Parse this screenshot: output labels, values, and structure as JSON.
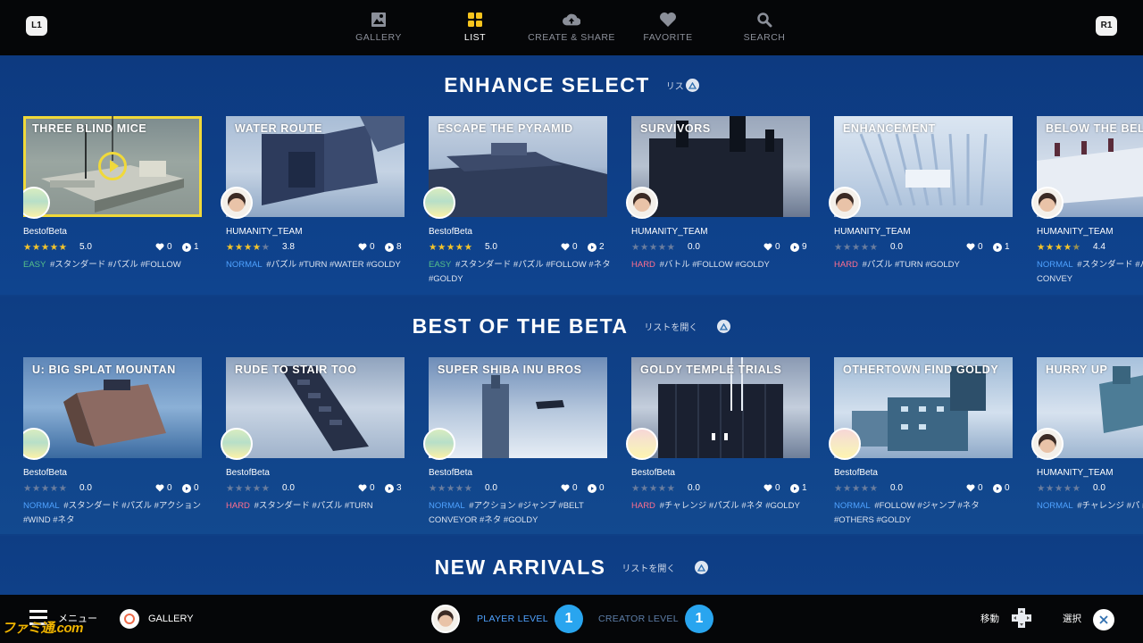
{
  "topbar": {
    "l1": "L1",
    "r1": "R1",
    "nav": [
      {
        "label": "GALLERY",
        "icon": "gallery-icon"
      },
      {
        "label": "LIST",
        "icon": "grid-icon",
        "active": true
      },
      {
        "label": "CREATE & SHARE",
        "icon": "cloud-upload-icon"
      },
      {
        "label": "FAVORITE",
        "icon": "heart-icon"
      },
      {
        "label": "SEARCH",
        "icon": "search-icon"
      }
    ]
  },
  "sections": [
    {
      "title": "ENHANCE SELECT",
      "open_label": "リス",
      "cards": [
        {
          "title": "THREE BLIND MICE",
          "creator": "BestofBeta",
          "stars": 5,
          "rating": "5.0",
          "likes": "0",
          "plays": "1",
          "difficulty": "EASY",
          "tags": "#スタンダード #パズル #FOLLOW",
          "selected": true
        },
        {
          "title": "WATER ROUTE",
          "creator": "HUMANITY_TEAM",
          "stars": 4,
          "rating": "3.8",
          "likes": "0",
          "plays": "8",
          "difficulty": "NORMAL",
          "tags": "#パズル #TURN #WATER #GOLDY"
        },
        {
          "title": "ESCAPE THE PYRAMID",
          "creator": "BestofBeta",
          "stars": 5,
          "rating": "5.0",
          "likes": "0",
          "plays": "2",
          "difficulty": "EASY",
          "tags": "#スタンダード #パズル #FOLLOW #ネタ #GOLDY"
        },
        {
          "title": "SURVIVORS",
          "creator": "HUMANITY_TEAM",
          "stars": 0,
          "rating": "0.0",
          "likes": "0",
          "plays": "9",
          "difficulty": "HARD",
          "tags": "#バトル #FOLLOW #GOLDY"
        },
        {
          "title": "ENHANCEMENT",
          "creator": "HUMANITY_TEAM",
          "stars": 0,
          "rating": "0.0",
          "likes": "0",
          "plays": "1",
          "difficulty": "HARD",
          "tags": "#パズル #TURN #GOLDY"
        },
        {
          "title": "BELOW THE BEL",
          "creator": "HUMANITY_TEAM",
          "stars": 4.5,
          "rating": "4.4",
          "likes": "",
          "plays": "",
          "difficulty": "NORMAL",
          "tags": "#スタンダード #パ ル #TURN #BELT CONVEY"
        }
      ]
    },
    {
      "title": "BEST OF THE BETA",
      "open_label": "リストを開く",
      "cards": [
        {
          "title": "U: BIG SPLAT MOUNTAN",
          "creator": "BestofBeta",
          "stars": 0,
          "rating": "0.0",
          "likes": "0",
          "plays": "0",
          "difficulty": "NORMAL",
          "tags": "#スタンダード #パズル #アクション #WIND #ネタ"
        },
        {
          "title": "RUDE TO STAIR TOO",
          "creator": "BestofBeta",
          "stars": 0,
          "rating": "0.0",
          "likes": "0",
          "plays": "3",
          "difficulty": "HARD",
          "tags": "#スタンダード #パズル #TURN"
        },
        {
          "title": "SUPER SHIBA INU BROS",
          "creator": "BestofBeta",
          "stars": 0,
          "rating": "0.0",
          "likes": "0",
          "plays": "0",
          "difficulty": "NORMAL",
          "tags": "#アクション #ジャンプ #BELT CONVEYOR #ネタ #GOLDY"
        },
        {
          "title": "GOLDY TEMPLE TRIALS",
          "creator": "BestofBeta",
          "stars": 0,
          "rating": "0.0",
          "likes": "0",
          "plays": "1",
          "difficulty": "HARD",
          "tags": "#チャレンジ #パズル #ネタ #GOLDY"
        },
        {
          "title": "OTHERTOWN FIND GOLDY",
          "creator": "BestofBeta",
          "stars": 0,
          "rating": "0.0",
          "likes": "0",
          "plays": "0",
          "difficulty": "NORMAL",
          "tags": "#FOLLOW #ジャンプ #ネタ #OTHERS #GOLDY"
        },
        {
          "title": "HURRY UP",
          "creator": "HUMANITY_TEAM",
          "stars": 0,
          "rating": "0.0",
          "likes": "",
          "plays": "",
          "difficulty": "NORMAL",
          "tags": "#チャレンジ #パ #FOLLOW #ネタ"
        }
      ]
    },
    {
      "title": "NEW ARRIVALS",
      "open_label": "リストを開く"
    }
  ],
  "bottombar": {
    "menu_label": "メニュー",
    "circle_label": "GALLERY",
    "player_level_label": "PLAYER LEVEL",
    "player_level": "1",
    "creator_level_label": "CREATOR LEVEL",
    "creator_level": "1",
    "move_label": "移動",
    "select_label": "選択"
  },
  "watermark": "ファミ通.com"
}
